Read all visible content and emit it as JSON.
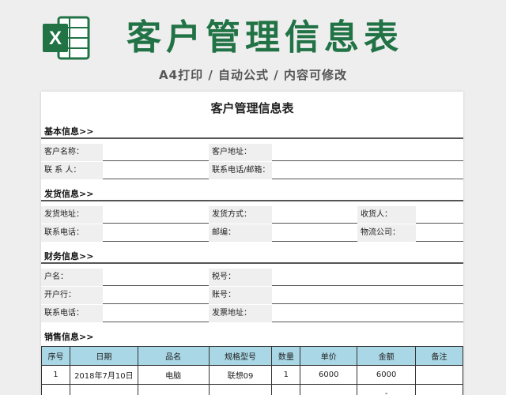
{
  "header": {
    "title": "客户管理信息表",
    "subtitle": "A4打印 / 自动公式 / 内容可修改",
    "logo_letter": "X"
  },
  "sheet": {
    "title": "客户管理信息表",
    "basic": {
      "heading": "基本信息>>",
      "customer_name": "客户名称：",
      "customer_address": "客户地址：",
      "contact": "联 系 人：",
      "phone_email": "联系电话/邮箱："
    },
    "shipping": {
      "heading": "发货信息>>",
      "ship_address": "发货地址：",
      "ship_method": "发货方式：",
      "receiver": "收货人：",
      "phone": "联系电话：",
      "postcode": "邮编：",
      "logistics": "物流公司："
    },
    "finance": {
      "heading": "财务信息>>",
      "account_name": "户名：",
      "tax_no": "税号：",
      "bank": "开户行：",
      "account_no": "账号：",
      "phone": "联系电话：",
      "invoice_address": "发票地址："
    },
    "sales": {
      "heading": "销售信息>>",
      "columns": [
        "序号",
        "日期",
        "品名",
        "规格型号",
        "数量",
        "单价",
        "金额",
        "备注"
      ],
      "rows": [
        [
          "1",
          "2018年7月10日",
          "电脑",
          "联想09",
          "1",
          "6000",
          "6000",
          ""
        ],
        [
          "",
          "",
          "",
          "",
          "",
          "",
          "-",
          ""
        ]
      ]
    }
  },
  "colors": {
    "brand_green": "#217346",
    "table_header": "#a9d7e6"
  }
}
